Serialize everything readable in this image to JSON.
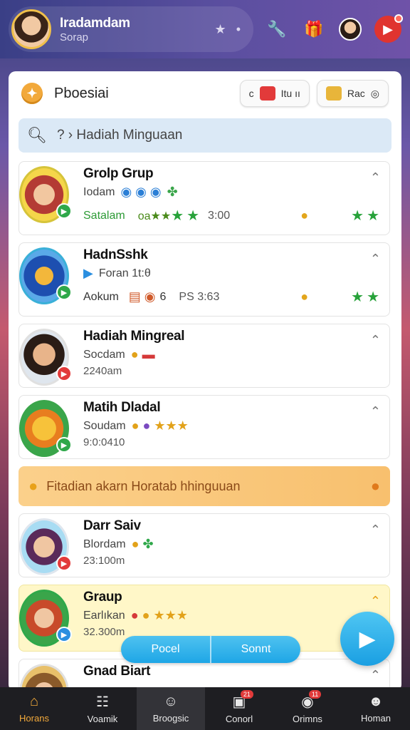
{
  "header": {
    "profile_name": "Iradamdam",
    "profile_sub": "Sorap",
    "pill_icons": [
      "★",
      "•"
    ]
  },
  "panel": {
    "title": "Pboesiai",
    "buttons": [
      {
        "prefix": "c",
        "label": "Itu ıı"
      },
      {
        "prefix": "",
        "label": "Rac"
      }
    ],
    "search_placeholder": "? › Hadiah Minguaan"
  },
  "items": [
    {
      "title": "Grolp Grup",
      "sub": "Iodam",
      "status": "Satalam",
      "score": "3:00",
      "extra": "oa★★"
    },
    {
      "title": "HadnSshk",
      "sub": "Foran 1t:θ",
      "status": "Aokum",
      "score": "PS 3:63",
      "extra": "6"
    },
    {
      "title": "Hadiah Mingreal",
      "sub": "Socdam",
      "time": "2240am"
    },
    {
      "title": "Matih Dladal",
      "sub": "Soudam",
      "time": "9:0:0410"
    }
  ],
  "banner": {
    "text": "Fitadian akarn Horatab hhinguuan"
  },
  "items2": [
    {
      "title": "Darr Saiv",
      "sub": "Blordam",
      "time": "23:100m"
    },
    {
      "title": "Graup",
      "sub": "Earlıkan",
      "time": "32.300m"
    },
    {
      "title": "Gnad Biart"
    }
  ],
  "pill": {
    "left": "Pocel",
    "right": "Sonnt"
  },
  "nav": [
    {
      "label": "Horans",
      "badge": ""
    },
    {
      "label": "Voamik",
      "badge": ""
    },
    {
      "label": "Broogsic",
      "badge": ""
    },
    {
      "label": "Conorl",
      "badge": "21"
    },
    {
      "label": "Orimns",
      "badge": "11"
    },
    {
      "label": "Homan",
      "badge": ""
    }
  ]
}
